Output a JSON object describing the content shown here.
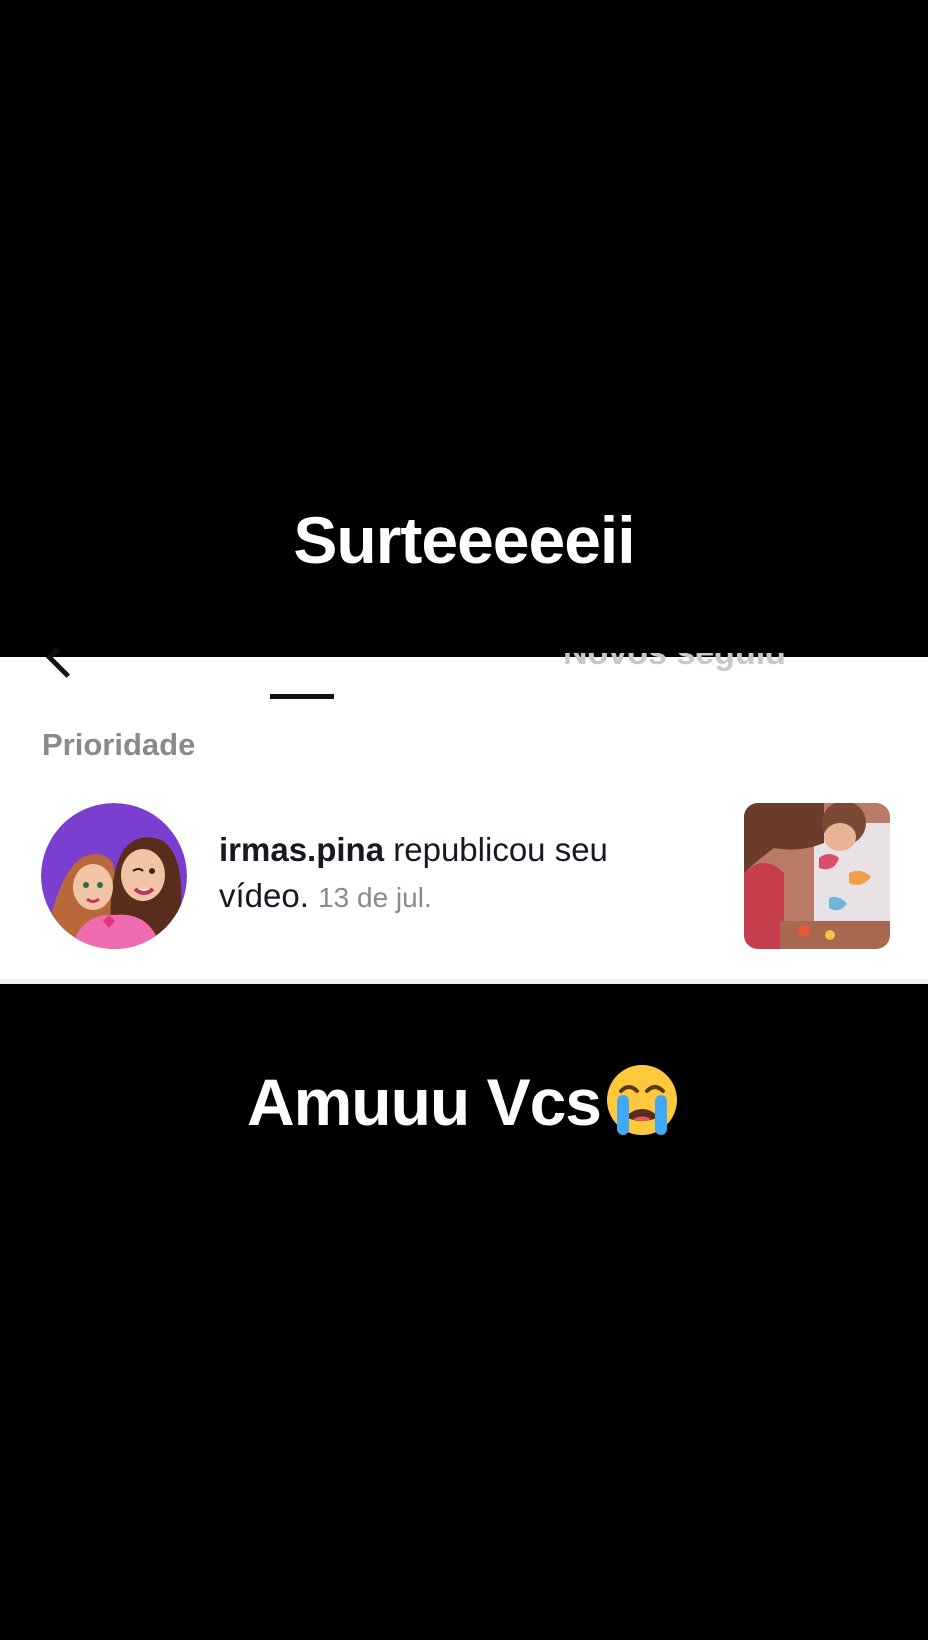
{
  "captions": {
    "top": "Surteeeeeii",
    "bottom": "Amuuu Vcs",
    "bottom_emoji": "crying-face-emoji"
  },
  "header": {
    "back_icon": "chevron-left-icon",
    "tab_partial_label": "Novos seguid"
  },
  "section": {
    "title": "Prioridade"
  },
  "notification": {
    "username": "irmas.pina",
    "action": "republicou seu vídeo.",
    "time": "13 de jul.",
    "avatar_icon": "avatar-illustration",
    "thumbnail_icon": "video-thumbnail"
  },
  "colors": {
    "background": "#000000",
    "panel": "#ffffff",
    "caption": "#ffffff",
    "section_title": "#8a8a8a",
    "timestamp": "#8a8b91",
    "avatar_bg": "#7a3fd1"
  }
}
